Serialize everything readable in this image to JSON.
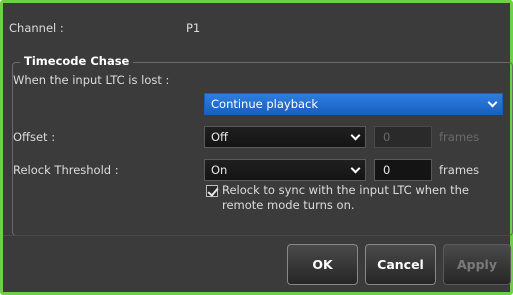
{
  "channel": {
    "label": "Channel :",
    "value": "P1"
  },
  "timecode_chase": {
    "title": "Timecode Chase",
    "lost_label": "When the input LTC is lost :",
    "lost_option": "Continue playback",
    "offset": {
      "label": "Offset :",
      "option": "Off",
      "value": "0",
      "unit": "frames"
    },
    "relock": {
      "label": "Relock Threshold :",
      "option": "On",
      "value": "0",
      "unit": "frames"
    },
    "checkbox": {
      "checked": true,
      "line1": "Relock to sync with the input LTC when the",
      "line2": "remote mode turns on."
    }
  },
  "buttons": {
    "ok": "OK",
    "cancel": "Cancel",
    "apply": "Apply"
  },
  "colors": {
    "frame": "#6fcf4a",
    "accent": "#2d7fe0",
    "background": "#3b3b3b"
  }
}
